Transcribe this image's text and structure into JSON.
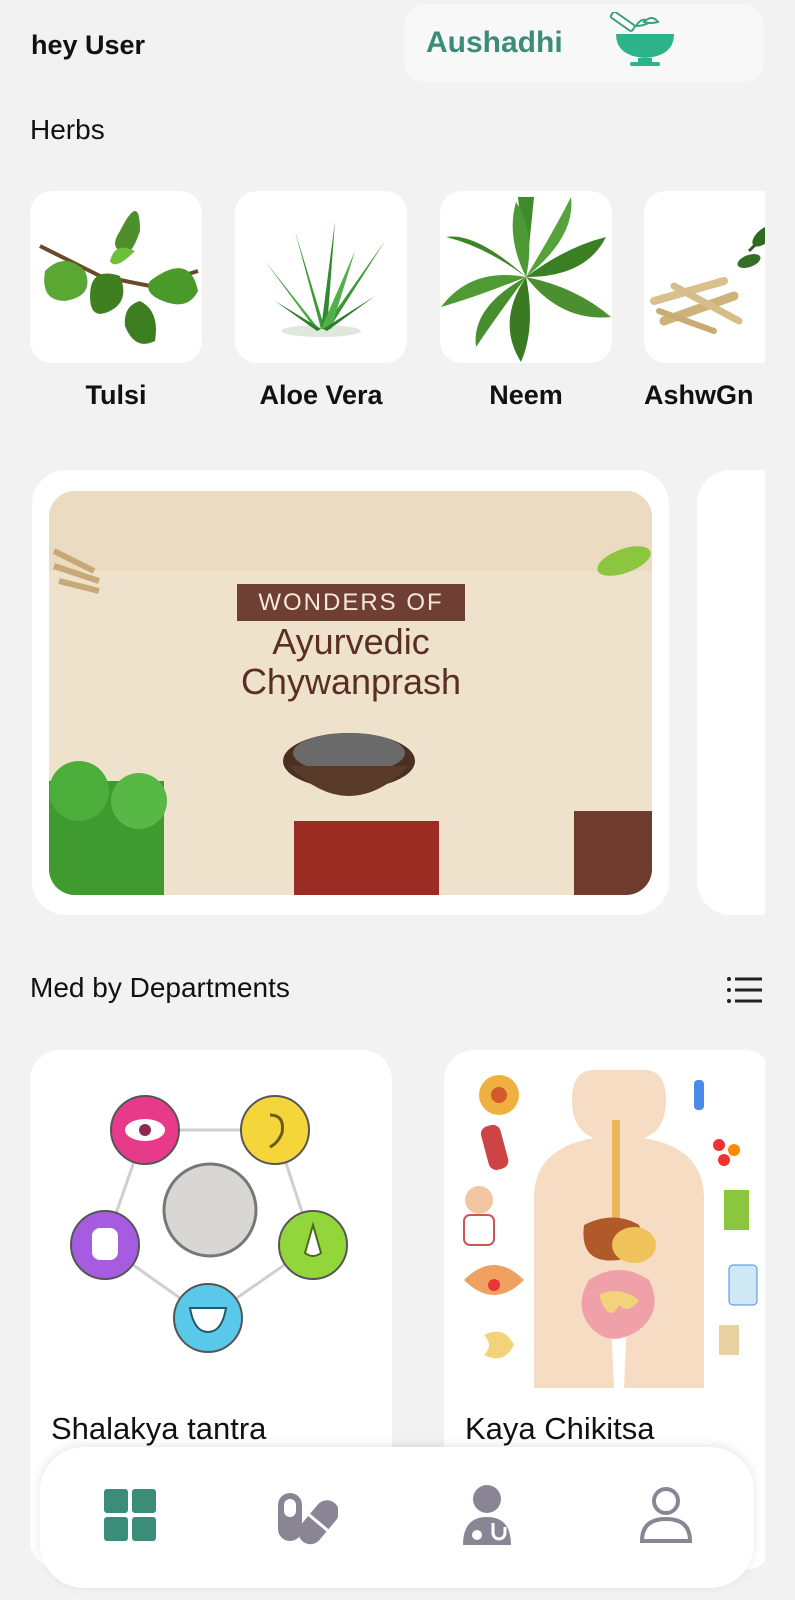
{
  "header": {
    "greeting": "hey User",
    "brand_name": "Aushadhi",
    "brand_icon": "mortar-pestle-icon",
    "brand_color": "#3b8d7a"
  },
  "herbs": {
    "title": "Herbs",
    "items": [
      {
        "label": "Tulsi",
        "icon": "tulsi-leaf-image"
      },
      {
        "label": "Aloe Vera",
        "icon": "aloe-vera-image"
      },
      {
        "label": "Neem",
        "icon": "neem-leaf-image"
      },
      {
        "label": "AshwGn",
        "icon": "ashwagandha-root-image"
      }
    ]
  },
  "banner": {
    "tag": "WONDERS OF",
    "line1": "Ayurvedic",
    "line2": "Chywanprash"
  },
  "departments": {
    "title": "Med by Departments",
    "menu_icon": "list-icon",
    "items": [
      {
        "label": "Shalakya tantra",
        "icon": "senses-diagram-image"
      },
      {
        "label": "Kaya Chikitsa",
        "icon": "digestive-system-image"
      }
    ]
  },
  "nav": {
    "items": [
      {
        "icon": "grid-icon",
        "active": true
      },
      {
        "icon": "pills-icon",
        "active": false
      },
      {
        "icon": "doctor-icon",
        "active": false
      },
      {
        "icon": "profile-icon",
        "active": false
      }
    ],
    "active_color": "#3b8d7a",
    "inactive_color": "#8a8595"
  }
}
